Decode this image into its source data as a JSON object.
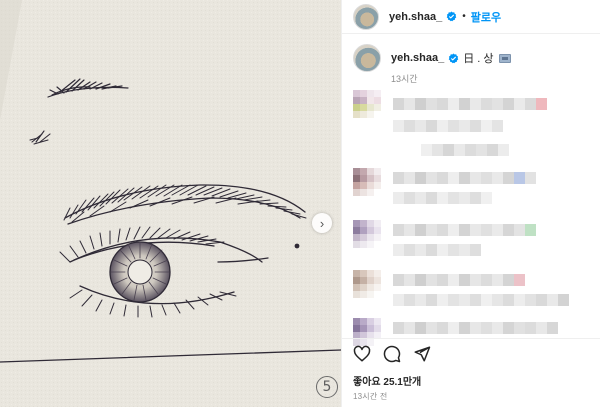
{
  "post": {
    "username": "yeh.shaa_",
    "follow_label": "팔로우",
    "separator": "•",
    "caption": "日 . 상",
    "caption_time": "13시간",
    "likes": "좋아요 25.1만개",
    "post_time": "13시간 전",
    "image_page_number": "5"
  },
  "colors": {
    "link_blue": "#0095f6",
    "verified_blue": "#0095f6",
    "paper": "#e9e6de",
    "ink": "#2b2530",
    "muted_text": "#8e8e8e"
  },
  "icons": {
    "verified": "verified-badge-icon",
    "next": "chevron-right-icon",
    "like": "heart-icon",
    "comment": "comment-bubble-icon",
    "share": "paper-plane-icon",
    "caption_emoji": "flag-icon"
  },
  "comments": [
    {
      "avatar": [
        "#d9c7d6",
        "#e4d2de",
        "#efe6ec",
        "#f5eef3",
        "#b9a4b6",
        "#c9b3c4",
        "#f2e7ea",
        "#eddde3",
        "#cbd08c",
        "#d8da9f",
        "#e7e7d0",
        "#f1efe4",
        "#e5e0c8",
        "#eeeadc",
        "#f6f4ee",
        "#ffffff"
      ],
      "lines": [
        [
          "#d6d6d6",
          "#e6e6e6",
          "#cfcfcf",
          "#e0e0e0",
          "#d9d9d9",
          "#ededed",
          "#d2d2d2",
          "#e9e9e9",
          "#dcdcdc",
          "#e2e2e2",
          "#d4d4d4",
          "#eaeaea",
          "#dadada",
          "#efb8bd"
        ],
        [
          "#ececec",
          "#dedede",
          "#e8e8e8",
          "#d9d9d9",
          "#eeeeee",
          "#e1e1e1",
          "#e9e9e9",
          "#dddddd",
          "#f0f0f0",
          "#e4e4e4"
        ],
        [
          "#efefef",
          "#e4e4e4",
          "#d6d6d6",
          "#e9e9e9",
          "#dcdcdc",
          "#e3e3e3",
          "#d8d8d8",
          "#ececec"
        ]
      ]
    },
    {
      "avatar": [
        "#a88e96",
        "#c3a8ae",
        "#e5d8da",
        "#f2ecee",
        "#8b7077",
        "#b89ba2",
        "#d6c2c6",
        "#e8dcde",
        "#c4a3a0",
        "#d7bcb8",
        "#eadcd9",
        "#f4eeec",
        "#e1d3d0",
        "#ece3e1",
        "#f5f0ef",
        "#ffffff"
      ],
      "lines": [
        [
          "#d9d9d9",
          "#e6e6e6",
          "#cfcfcf",
          "#e3e3e3",
          "#dadada",
          "#eeeeee",
          "#d3d3d3",
          "#e7e7e7",
          "#dfdfdf",
          "#e9e9e9",
          "#d5d5d5",
          "#b9c7e6",
          "#e2e2e2"
        ],
        [
          "#ececec",
          "#dfdfdf",
          "#e9e9e9",
          "#dbdbdb",
          "#efefef",
          "#e3e3e3",
          "#eaeaea",
          "#dedede",
          "#f0f0f0"
        ]
      ]
    },
    {
      "avatar": [
        "#a697b6",
        "#c2b4cc",
        "#e1d9e6",
        "#f1edf3",
        "#8c7c9e",
        "#b0a1bf",
        "#d4c9dc",
        "#e9e3ee",
        "#c3b7ca",
        "#d6ccdb",
        "#eae5ed",
        "#f5f2f6",
        "#e2dde5",
        "#ede9ef",
        "#f6f4f7",
        "#ffffff"
      ],
      "lines": [
        [
          "#dadada",
          "#e6e6e6",
          "#d0d0d0",
          "#e4e4e4",
          "#dbdbdb",
          "#eeeeee",
          "#d4d4d4",
          "#e8e8e8",
          "#e0e0e0",
          "#eaeaea",
          "#d6d6d6",
          "#e3e3e3",
          "#bfe1c4"
        ],
        [
          "#ececec",
          "#dfdfdf",
          "#e9e9e9",
          "#dbdbdb",
          "#efefef",
          "#e3e3e3",
          "#eaeaea",
          "#dedede"
        ]
      ]
    },
    {
      "avatar": [
        "#c7b4a8",
        "#d8c7bc",
        "#ebe0d9",
        "#f4eeea",
        "#ae988b",
        "#c5b1a5",
        "#e0d2ca",
        "#ede4de",
        "#d2c2b6",
        "#e0d4ca",
        "#efe8e2",
        "#f7f3f0",
        "#e8e1da",
        "#f0ebe6",
        "#f7f5f2",
        "#ffffff"
      ],
      "lines": [
        [
          "#d8d8d8",
          "#e5e5e5",
          "#cfcfcf",
          "#e2e2e2",
          "#d9d9d9",
          "#ededed",
          "#d2d2d2",
          "#e6e6e6",
          "#dcdcdc",
          "#e8e8e8",
          "#d4d4d4",
          "#ecc2c8"
        ],
        [
          "#ececec",
          "#dfdfdf",
          "#e9e9e9",
          "#dbdbdb",
          "#efefef",
          "#e3e3e3",
          "#eaeaea",
          "#dedede",
          "#f0f0f0",
          "#e6e6e6",
          "#dcdcdc",
          "#ededed",
          "#e2e2e2",
          "#d9d9d9",
          "#e9e9e9",
          "#d3d3d3"
        ]
      ]
    },
    {
      "avatar": [
        "#9c8cae",
        "#b9aac8",
        "#d9cfe2",
        "#ece7f1",
        "#85749a",
        "#a695b8",
        "#cbbfd8",
        "#e2dbe9",
        "#bdb0c9",
        "#d1c6da",
        "#e7e1ec",
        "#f3f0f6",
        "#ddd7e3",
        "#e9e5ee",
        "#f4f2f6",
        "#ffffff"
      ],
      "lines": [
        [
          "#d9d9d9",
          "#e6e6e6",
          "#cfcfcf",
          "#e3e3e3",
          "#dadada",
          "#eeeeee",
          "#d3d3d3",
          "#e7e7e7",
          "#dfdfdf",
          "#e9e9e9",
          "#d5d5d5",
          "#e1e1e1",
          "#dcdcdc",
          "#e8e8e8",
          "#d7d7d7"
        ]
      ]
    }
  ]
}
